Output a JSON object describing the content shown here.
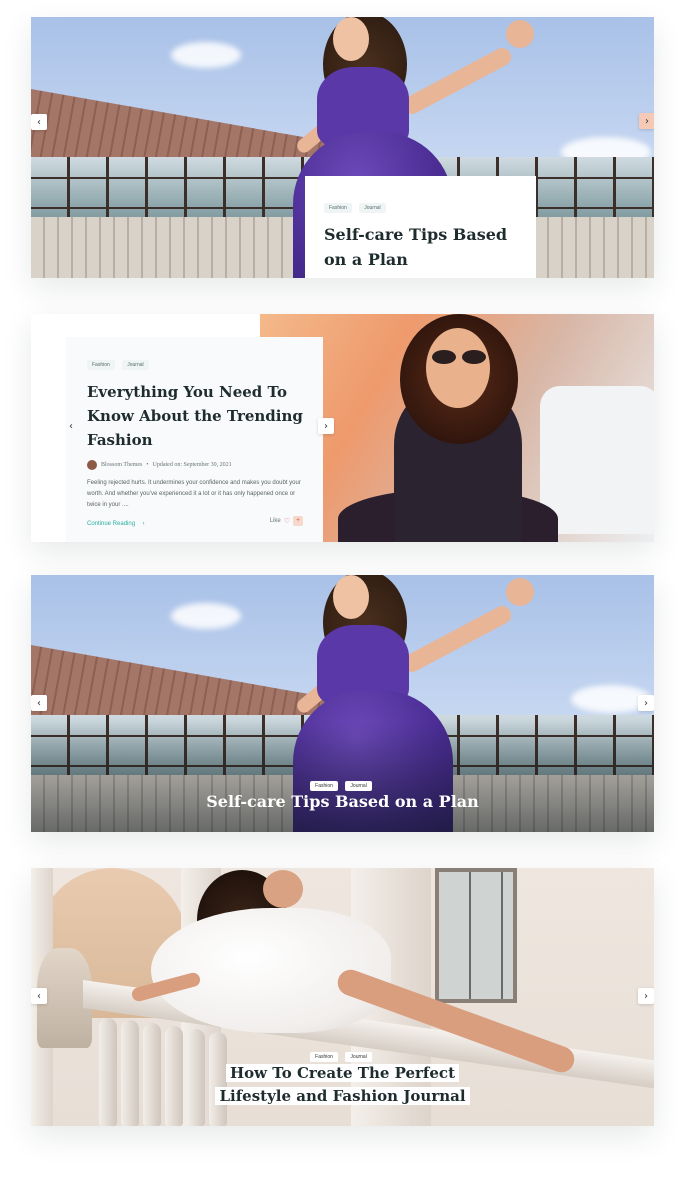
{
  "slides": [
    {
      "tags": [
        "Fashion",
        "Journal"
      ],
      "title": "Self-care Tips Based on a Plan",
      "nav_prev": "‹",
      "nav_next": "›"
    },
    {
      "tags": [
        "Fashion",
        "Journal"
      ],
      "title": "Everything You Need To Know About the Trending Fashion",
      "author": "Blossom Themes",
      "separator": "•",
      "updated": "Updated on: September 30, 2021",
      "excerpt": "Feeling rejected hurts. It undermines your confidence and makes you doubt your worth. And whether you’ve experienced it a lot or it has only happened once or twice in your ....",
      "read_more": "Continue Reading",
      "read_more_arrow": "›",
      "like_label": "Like",
      "heart": "♡",
      "plus": "+",
      "nav_prev": "‹",
      "nav_next": "›"
    },
    {
      "tags": [
        "Fashion",
        "Journal"
      ],
      "title": "Self-care Tips Based on a Plan",
      "nav_prev": "‹",
      "nav_next": "›"
    },
    {
      "tags": [
        "Fashion",
        "Journal"
      ],
      "title": "How To Create The Perfect Lifestyle and Fashion Journal",
      "nav_prev": "‹",
      "nav_next": "›"
    }
  ],
  "colors": {
    "accent": "#2ab1a4",
    "nav_active": "#f6c9b6",
    "title": "#1f2c2e"
  }
}
